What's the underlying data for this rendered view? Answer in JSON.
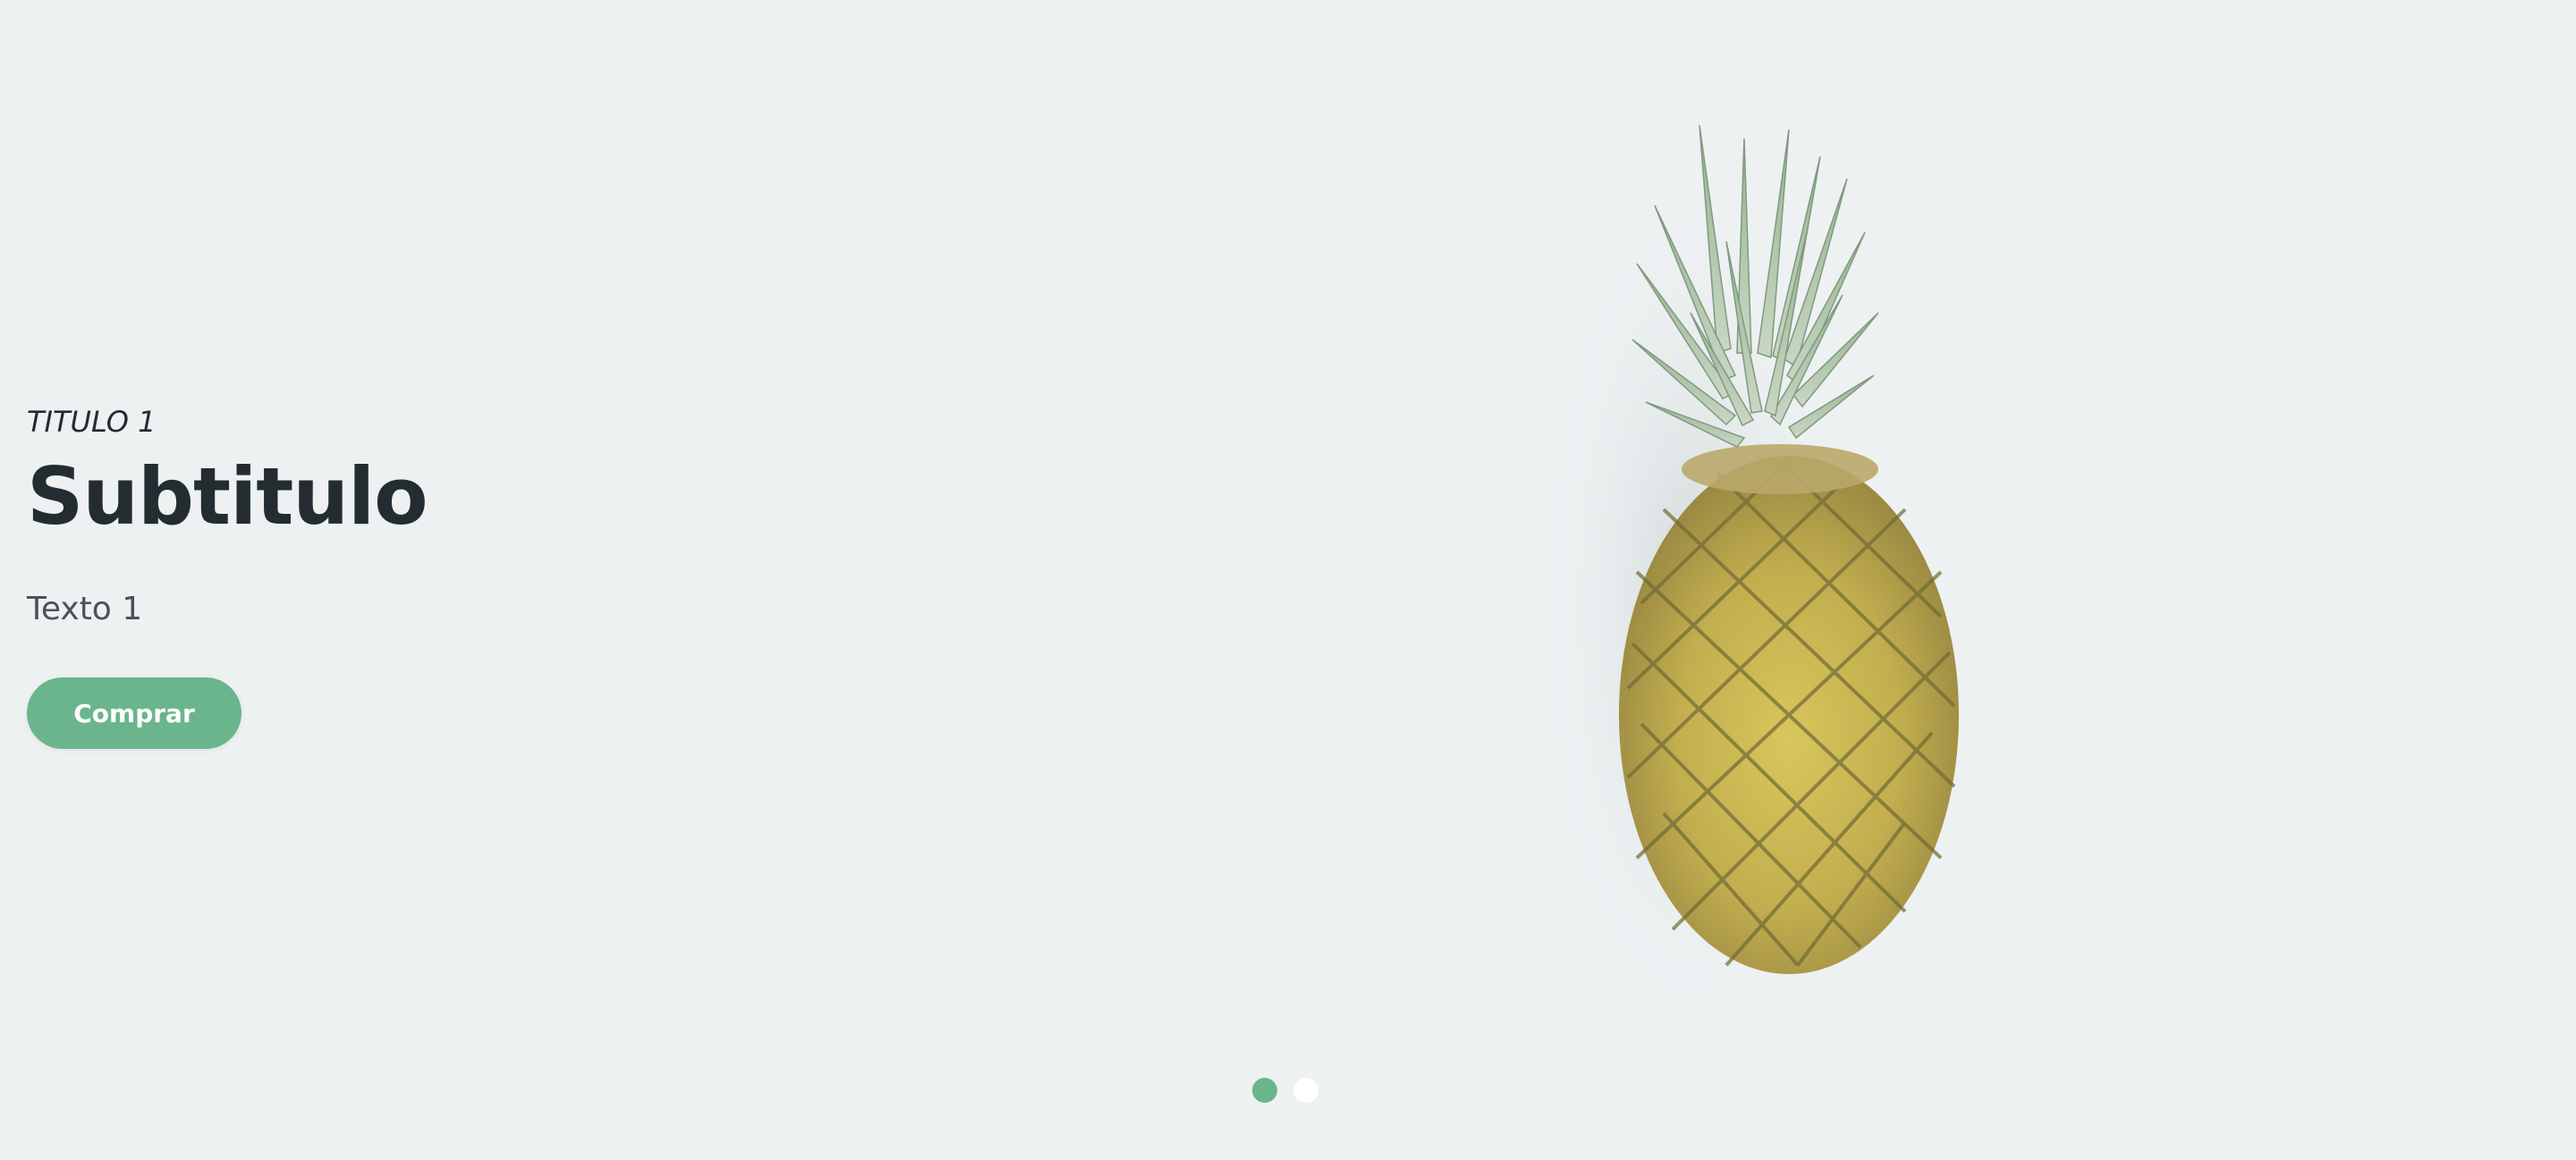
{
  "hero": {
    "eyebrow": "TITULO 1",
    "headline": "Subtitulo",
    "body": "Texto 1",
    "cta_label": "Comprar",
    "image_subject": "pineapple",
    "pagination": {
      "total": 2,
      "active": 1
    }
  },
  "colors": {
    "background": "#edf1f2",
    "accent": "#6bb58d",
    "headline": "#232d31",
    "body": "#4b5358",
    "dot_inactive": "#ffffff"
  }
}
